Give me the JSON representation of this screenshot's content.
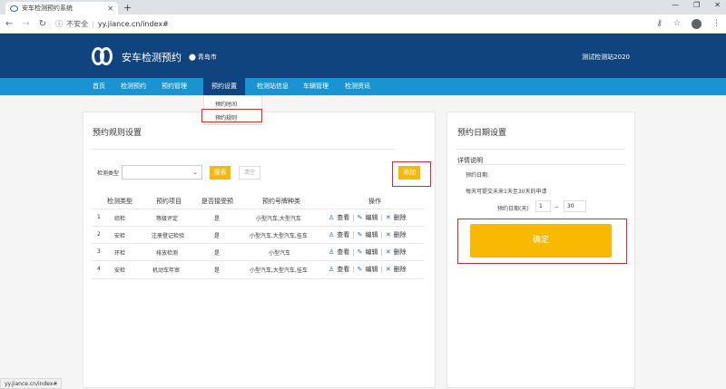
{
  "browser": {
    "tab_title": "安车检测预约系统",
    "not_secure": "不安全",
    "url": "yy.jiance.cn/index#",
    "status_url": "yy.jiance.cn/index#"
  },
  "header": {
    "brand": "安车检测预约",
    "city": "青岛市",
    "station": "测试检测站2020"
  },
  "nav": {
    "items": [
      "首页",
      "检测预约",
      "预约管理",
      "预约设置",
      "检测站信息",
      "车辆管理",
      "检测资讯"
    ],
    "dropdown": [
      "预约时间",
      "预约规则"
    ]
  },
  "rules": {
    "title": "预约规则设置",
    "filter_label": "检测类型",
    "search_label": "搜索",
    "clear_label": "清空",
    "add_label": "添加",
    "columns": [
      "检测类型",
      "预约项目",
      "是否接受预",
      "预约号牌种类",
      "操作"
    ],
    "rows": [
      {
        "no": "1",
        "type": "综检",
        "item": "等级评定",
        "accept": "是",
        "plates": "小型汽车,大型汽车"
      },
      {
        "no": "2",
        "type": "安检",
        "item": "注册登记检验",
        "accept": "是",
        "plates": "小型汽车,大型汽车,挂车"
      },
      {
        "no": "3",
        "type": "环检",
        "item": "排放检测",
        "accept": "是",
        "plates": "小型汽车"
      },
      {
        "no": "4",
        "type": "安检",
        "item": "机动车年审",
        "accept": "是",
        "plates": "小型汽车,大型汽车,挂车"
      }
    ],
    "actions": {
      "view": "查看",
      "edit": "编辑",
      "delete": "删除"
    }
  },
  "date_settings": {
    "title": "预约日期设置",
    "detail_heading": "详情说明",
    "detail_label": "预约日期:",
    "detail_text": "每天可提交未来1天至30天的申请",
    "range_label": "预约日期(天)",
    "range_from": "1",
    "range_sep": "--",
    "range_to": "30",
    "confirm_label": "确定"
  }
}
